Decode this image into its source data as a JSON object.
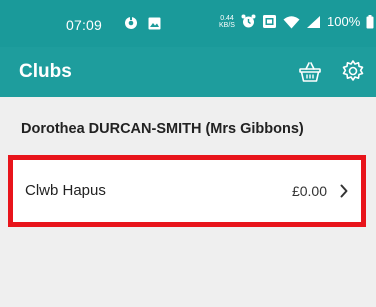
{
  "status_bar": {
    "time": "07:09",
    "net_speed_value": "0.44",
    "net_speed_unit": "KB/S",
    "battery": "100%",
    "left_icons": [
      "vpn-icon",
      "image-icon"
    ],
    "right_icons": [
      "alarm-icon",
      "sim-icon",
      "wifi-icon",
      "signal-icon",
      "battery-icon"
    ]
  },
  "app_bar": {
    "title": "Clubs",
    "actions": [
      "basket-icon",
      "settings-icon"
    ]
  },
  "member": {
    "name": "Dorothea DURCAN-SMITH (Mrs Gibbons)"
  },
  "clubs": [
    {
      "name": "Clwb Hapus",
      "amount": "£0.00"
    }
  ],
  "colors": {
    "status_bar": "#1a9a9a",
    "app_bar": "#1e9d9d",
    "highlight_border": "#e8141b",
    "background": "#efefef"
  }
}
